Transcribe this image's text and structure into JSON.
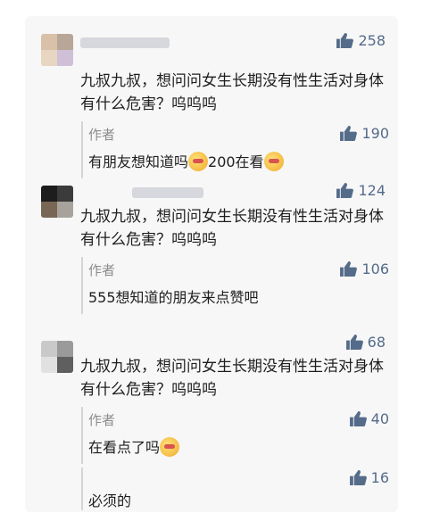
{
  "comments": [
    {
      "likes": "258",
      "text": "九叔九叔，想问问女生长期没有性生活对身体有什么危害？呜呜呜",
      "reply": {
        "author": "作者",
        "text_before": "有朋友想知道吗",
        "text_middle": "200在看",
        "likes": "190"
      }
    },
    {
      "likes": "124",
      "text": "九叔九叔，想问问女生长期没有性生活对身体有什么危害？呜呜呜",
      "reply": {
        "author": "作者",
        "text": "555想知道的朋友来点赞吧",
        "likes": "106"
      }
    },
    {
      "likes": "68",
      "text": "九叔九叔，想问问女生长期没有性生活对身体有什么危害？呜呜呜",
      "reply": {
        "author": "作者",
        "text": "在看点了吗",
        "likes": "40"
      },
      "reply2": {
        "text": "必须的",
        "likes": "16"
      }
    }
  ],
  "colors": {
    "like": "#556b8a",
    "author": "#8c8c8c",
    "card": "#f7f7f7"
  },
  "icons": {
    "like": "thumbs-up-icon",
    "emoji": "embarrassed-face-emoji"
  }
}
